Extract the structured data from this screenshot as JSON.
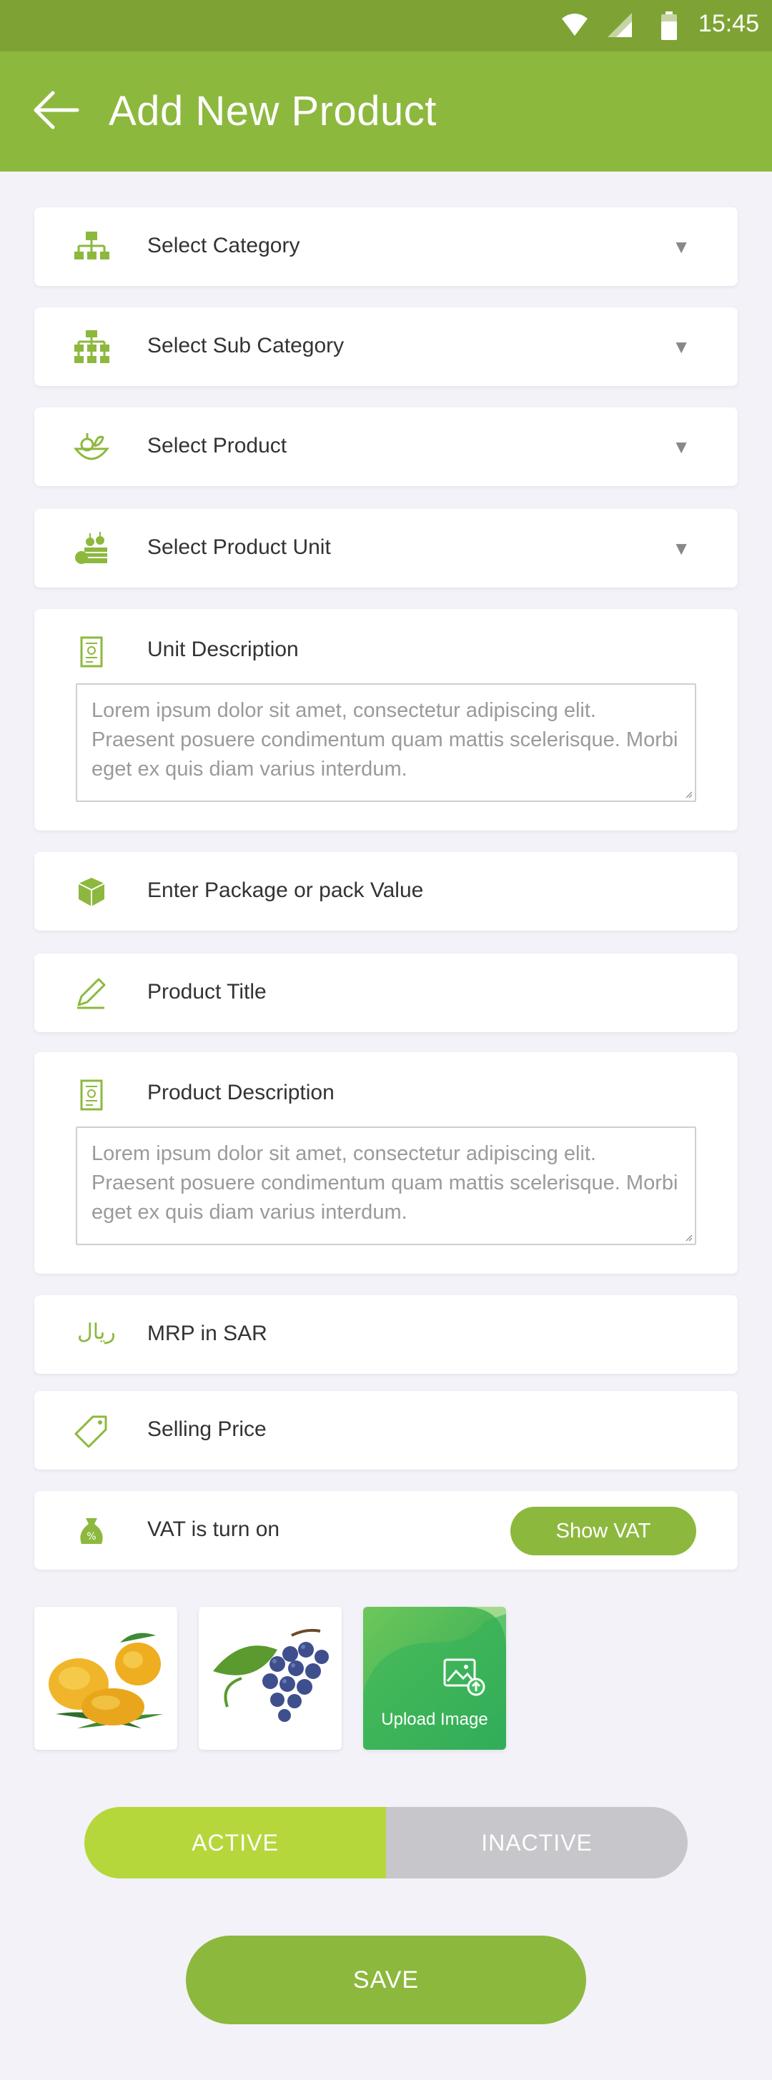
{
  "status_bar": {
    "time": "15:45"
  },
  "header": {
    "title": "Add New Product"
  },
  "form": {
    "category": {
      "label": "Select Category",
      "icon": "hierarchy-icon"
    },
    "sub_category": {
      "label": "Select Sub Category",
      "icon": "sub-hierarchy-icon"
    },
    "product": {
      "label": "Select Product",
      "icon": "basket-icon"
    },
    "product_unit": {
      "label": "Select Product Unit",
      "icon": "crate-icon"
    },
    "unit_description": {
      "label": "Unit Description",
      "value": "Lorem ipsum dolor sit amet, consectetur adipiscing elit. Praesent posuere condimentum quam mattis scelerisque. Morbi eget ex quis diam varius interdum."
    },
    "package_value": {
      "placeholder": "Enter Package or pack Value"
    },
    "product_title": {
      "placeholder": "Product Title"
    },
    "product_description": {
      "label": "Product Description",
      "value": "Lorem ipsum dolor sit amet, consectetur adipiscing elit. Praesent posuere condimentum quam mattis scelerisque. Morbi eget ex quis diam varius interdum."
    },
    "mrp": {
      "placeholder": "MRP in SAR",
      "currency_symbol": "ريال"
    },
    "selling_price": {
      "placeholder": "Selling Price"
    },
    "vat": {
      "label": "VAT is turn on",
      "button": "Show VAT"
    }
  },
  "images": {
    "upload_label": "Upload Image"
  },
  "status_toggle": {
    "active": "ACTIVE",
    "inactive": "INACTIVE",
    "selected": "ACTIVE"
  },
  "save_button": "SAVE",
  "colors": {
    "primary": "#8db83e",
    "status_bar": "#7ea334",
    "active": "#b5d73c",
    "inactive": "#c6c6cb"
  }
}
